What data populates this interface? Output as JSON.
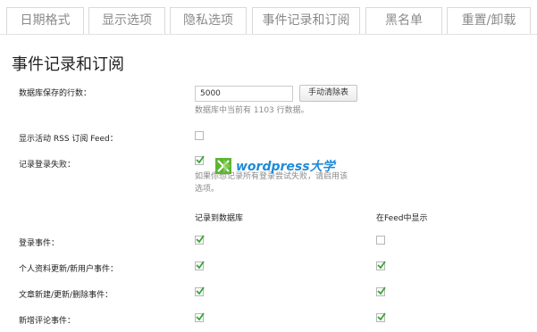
{
  "tabs": [
    "日期格式",
    "显示选项",
    "隐私选项",
    "事件记录和订阅",
    "黑名单",
    "重置/卸载"
  ],
  "section_title": "事件记录和订阅",
  "rows_setting": {
    "label": "数据库保存的行数：",
    "value": "5000",
    "button": "手动清除表",
    "help": "数据库中当前有 1103 行数据。"
  },
  "rss_setting": {
    "label": "显示活动 RSS 订阅 Feed：",
    "checked": false
  },
  "login_fail_setting": {
    "label": "记录登录失败：",
    "checked": true,
    "help_line1": "如果你想记录所有登录尝试失败，请启用该",
    "help_line2": "选项。"
  },
  "columns": {
    "db": "记录到数据库",
    "feed": "在Feed中显示"
  },
  "events": [
    {
      "label": "登录事件：",
      "db": true,
      "feed": false
    },
    {
      "label": "个人资料更新/新用户事件：",
      "db": true,
      "feed": true
    },
    {
      "label": "文章新建/更新/删除事件：",
      "db": true,
      "feed": true
    },
    {
      "label": "新增评论事件：",
      "db": true,
      "feed": true
    }
  ],
  "watermark": {
    "text": "wordpress大学",
    "colors": {
      "green": "#5cb531",
      "blue": "#1f8bd8"
    }
  }
}
